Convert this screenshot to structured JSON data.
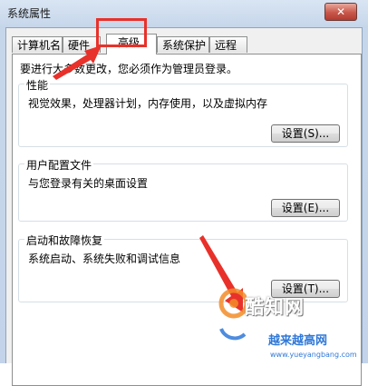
{
  "window": {
    "title": "系统属性",
    "close_label": "✕"
  },
  "tabs": [
    {
      "label": "计算机名"
    },
    {
      "label": "硬件"
    },
    {
      "label": "高级"
    },
    {
      "label": "系统保护"
    },
    {
      "label": "远程"
    }
  ],
  "admin_note": "要进行大多数更改，您必须作为管理员登录。",
  "groups": {
    "performance": {
      "title": "性能",
      "desc": "视觉效果，处理器计划，内存使用，以及虚拟内存",
      "button": "设置(S)..."
    },
    "profile": {
      "title": "用户配置文件",
      "desc": "与您登录有关的桌面设置",
      "button": "设置(E)..."
    },
    "startup": {
      "title": "启动和故障恢复",
      "desc": "系统启动、系统失败和调试信息",
      "button": "设置(T)..."
    }
  },
  "watermarks": {
    "main": "酷知网",
    "secondary": "越来越高网",
    "url": "www.yueyangbang.com"
  },
  "colors": {
    "highlight": "#e8312a",
    "title_bg": "#d9e5f3",
    "close": "#c8574a"
  }
}
